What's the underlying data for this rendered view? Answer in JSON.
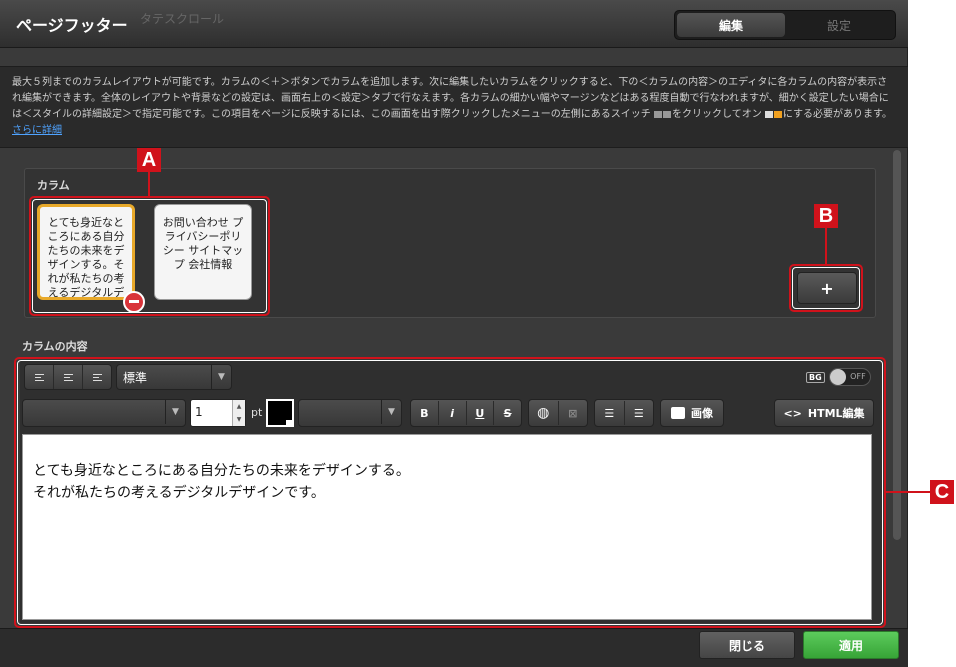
{
  "window": {
    "title": "ページフッター",
    "bg_ghost": "タテスクロール",
    "tabs": [
      {
        "label": "編集",
        "active": true
      },
      {
        "label": "設定",
        "active": false
      }
    ]
  },
  "info": {
    "text": "最大５列までのカラムレイアウトが可能です。カラムの＜＋＞ボタンでカラムを追加します。次に編集したいカラムをクリックすると、下の＜カラムの内容＞のエディタに各カラムの内容が表示され編集ができます。全体のレイアウトや背景などの設定は、画面右上の＜設定＞タブで行なえます。各カラムの細かい幅やマージンなどはある程度自動で行なわれますが、細かく設定したい場合には＜スタイルの詳細設定＞で指定可能です。この項目をページに反映するには、この画面を出す際クリックしたメニューの左側にあるスイッチ",
    "switch_text_a": "をクリックしてオン",
    "switch_text_b": "にする必要があります。",
    "link": "さらに詳細"
  },
  "columns": {
    "label": "カラム",
    "items": [
      {
        "text": "とても身近なところにある自分たちの未来をデザインする。それが私たちの考えるデジタルデザインです。",
        "selected": true
      },
      {
        "text": "お問い合わせ プライバシーポリシー サイトマップ 会社情報",
        "selected": false
      }
    ],
    "add_label": "+"
  },
  "content": {
    "label": "カラムの内容",
    "style_select": "標準",
    "bg_tag": "BG",
    "bg_toggle": "OFF",
    "font_size": "1",
    "unit": "pt",
    "format_buttons": [
      "B",
      "i",
      "U",
      "S"
    ],
    "image_button": "画像",
    "html_button": "HTML編集",
    "text_lines": [
      "とても身近なところにある自分たちの未来をデザインする。",
      "それが私たちの考えるデジタルデザインです。"
    ]
  },
  "footer": {
    "close": "閉じる",
    "apply": "適用"
  },
  "callouts": [
    "A",
    "B",
    "C"
  ],
  "colors": {
    "callout": "#d0121b",
    "apply": "#37a437",
    "link": "#4fa3ff",
    "selected_border": "#e8a92a"
  }
}
